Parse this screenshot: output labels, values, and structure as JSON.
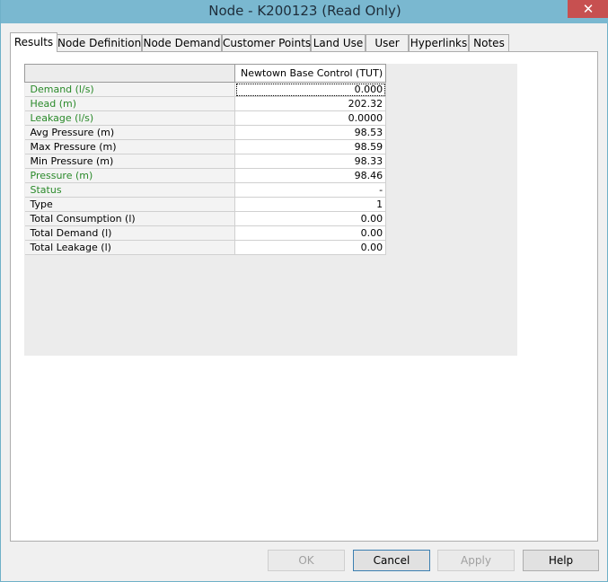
{
  "window": {
    "title": "Node - K200123 (Read Only)",
    "close_glyph": "✕"
  },
  "tabs": [
    {
      "label": "Results"
    },
    {
      "label": "Node Definition"
    },
    {
      "label": "Node Demand"
    },
    {
      "label": "Customer Points"
    },
    {
      "label": "Land Use"
    },
    {
      "label": "User"
    },
    {
      "label": "Hyperlinks"
    },
    {
      "label": "Notes"
    }
  ],
  "results": {
    "column_header": "Newtown Base Control (TUT)",
    "rows": [
      {
        "label": "Demand (l/s)",
        "value": "0.000"
      },
      {
        "label": "Head (m)",
        "value": "202.32"
      },
      {
        "label": "Leakage (l/s)",
        "value": "0.0000"
      },
      {
        "label": "Avg Pressure (m)",
        "value": "98.53"
      },
      {
        "label": "Max Pressure (m)",
        "value": "98.59"
      },
      {
        "label": "Min Pressure (m)",
        "value": "98.33"
      },
      {
        "label": "Pressure (m)",
        "value": "98.46"
      },
      {
        "label": "Status",
        "value": "-"
      },
      {
        "label": "Type",
        "value": "1"
      },
      {
        "label": "Total Consumption (l)",
        "value": "0.00"
      },
      {
        "label": "Total Demand (l)",
        "value": "0.00"
      },
      {
        "label": "Total Leakage (l)",
        "value": "0.00"
      }
    ]
  },
  "buttons": {
    "ok": "OK",
    "cancel": "Cancel",
    "apply": "Apply",
    "help": "Help"
  },
  "colors": {
    "title_bar": "#7ab8d0",
    "close_button": "#c75050",
    "green_label": "#2a8a2a"
  }
}
